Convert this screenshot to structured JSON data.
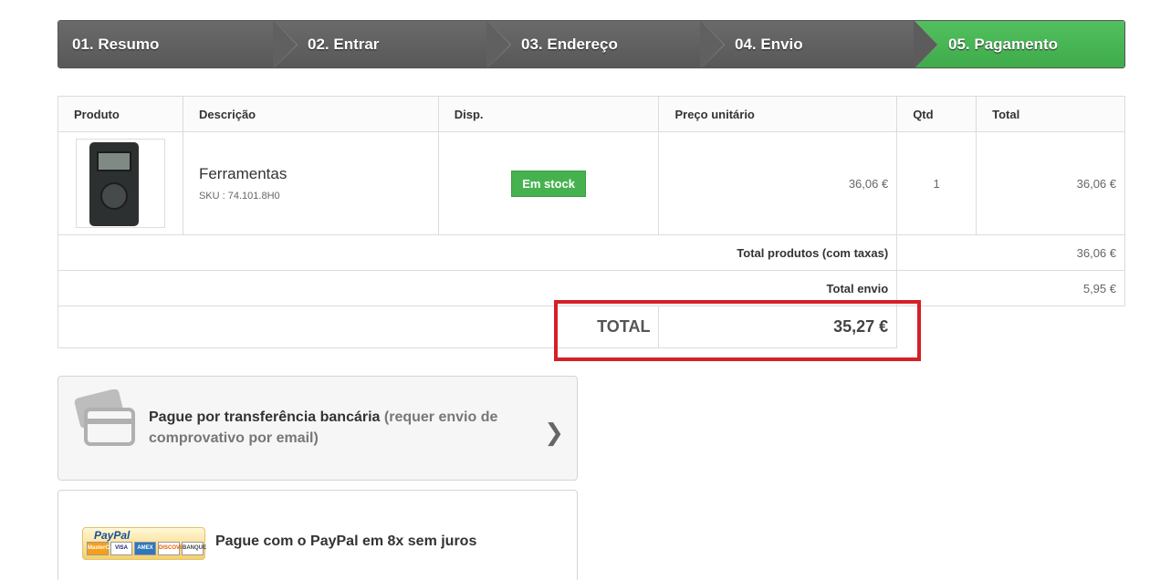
{
  "steps": [
    {
      "label": "01. Resumo"
    },
    {
      "label": "02. Entrar"
    },
    {
      "label": "03. Endereço"
    },
    {
      "label": "04. Envio"
    },
    {
      "label": "05. Pagamento"
    }
  ],
  "table": {
    "headers": {
      "produto": "Produto",
      "descricao": "Descrição",
      "disp": "Disp.",
      "preco": "Preço unitário",
      "qtd": "Qtd",
      "total": "Total"
    },
    "product": {
      "name": "Ferramentas",
      "sku": "SKU : 74.101.8H0",
      "availability": "Em stock",
      "unit_price": "36,06 €",
      "qty": "1",
      "total": "36,06 €"
    },
    "summary": {
      "products_label": "Total produtos (com taxas)",
      "products_value": "36,06 €",
      "shipping_label": "Total envio",
      "shipping_value": "5,95 €",
      "total_label": "TOTAL",
      "total_value": "35,27 €"
    }
  },
  "payment": {
    "bank": {
      "label": "Pague por transferência bancária",
      "note": "(requer envio de comprovativo por email)"
    },
    "paypal": {
      "logo_text": "PayPal",
      "label": "Pague com o PayPal em 8x sem juros",
      "cards": [
        "MasterCard",
        "VISA",
        "AMEX",
        "DISCOVER",
        "BANQUE"
      ]
    }
  },
  "colors": {
    "active_step": "#46b24f",
    "badge": "#46b24f",
    "highlight": "#d42027"
  }
}
